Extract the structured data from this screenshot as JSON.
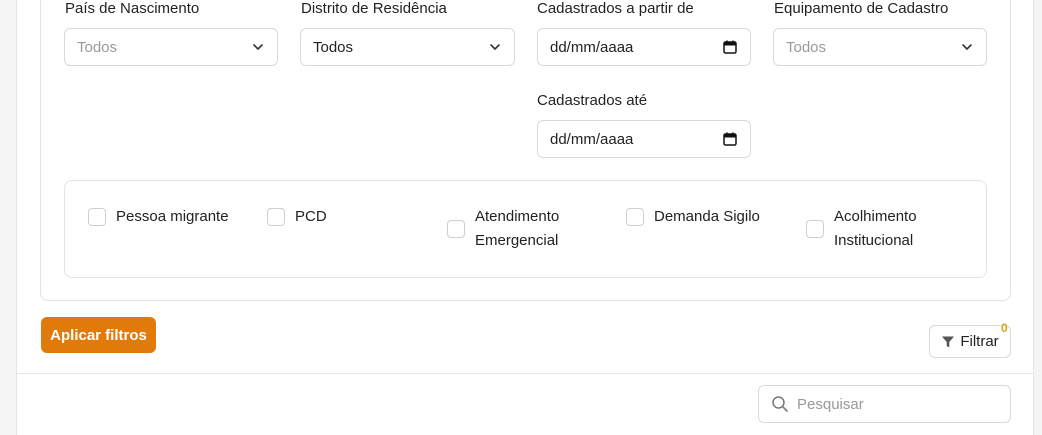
{
  "filters": {
    "country_of_birth": {
      "label": "País de Nascimento",
      "value": "Todos"
    },
    "district_of_residence": {
      "label": "Distrito de Residência",
      "value": "Todos"
    },
    "registered_from": {
      "label": "Cadastrados a partir de",
      "value": "dd/mm/aaaa"
    },
    "registration_equipment": {
      "label": "Equipamento de Cadastro",
      "value": "Todos"
    },
    "registered_until": {
      "label": "Cadastrados até",
      "value": "dd/mm/aaaa"
    }
  },
  "checkboxes": {
    "migrant": "Pessoa migrante",
    "pcd": "PCD",
    "emergency_line1": "Atendimento",
    "emergency_line2": "Emergencial",
    "secret": "Demanda Sigilo",
    "shelter_line1": "Acolhimento",
    "shelter_line2": "Institucional"
  },
  "actions": {
    "apply_label": "Aplicar filtros",
    "filter_label": "Filtrar",
    "filter_count": "0"
  },
  "search": {
    "placeholder": "Pesquisar"
  },
  "colors": {
    "accent": "#e07b0b",
    "badge": "#e0a010"
  }
}
